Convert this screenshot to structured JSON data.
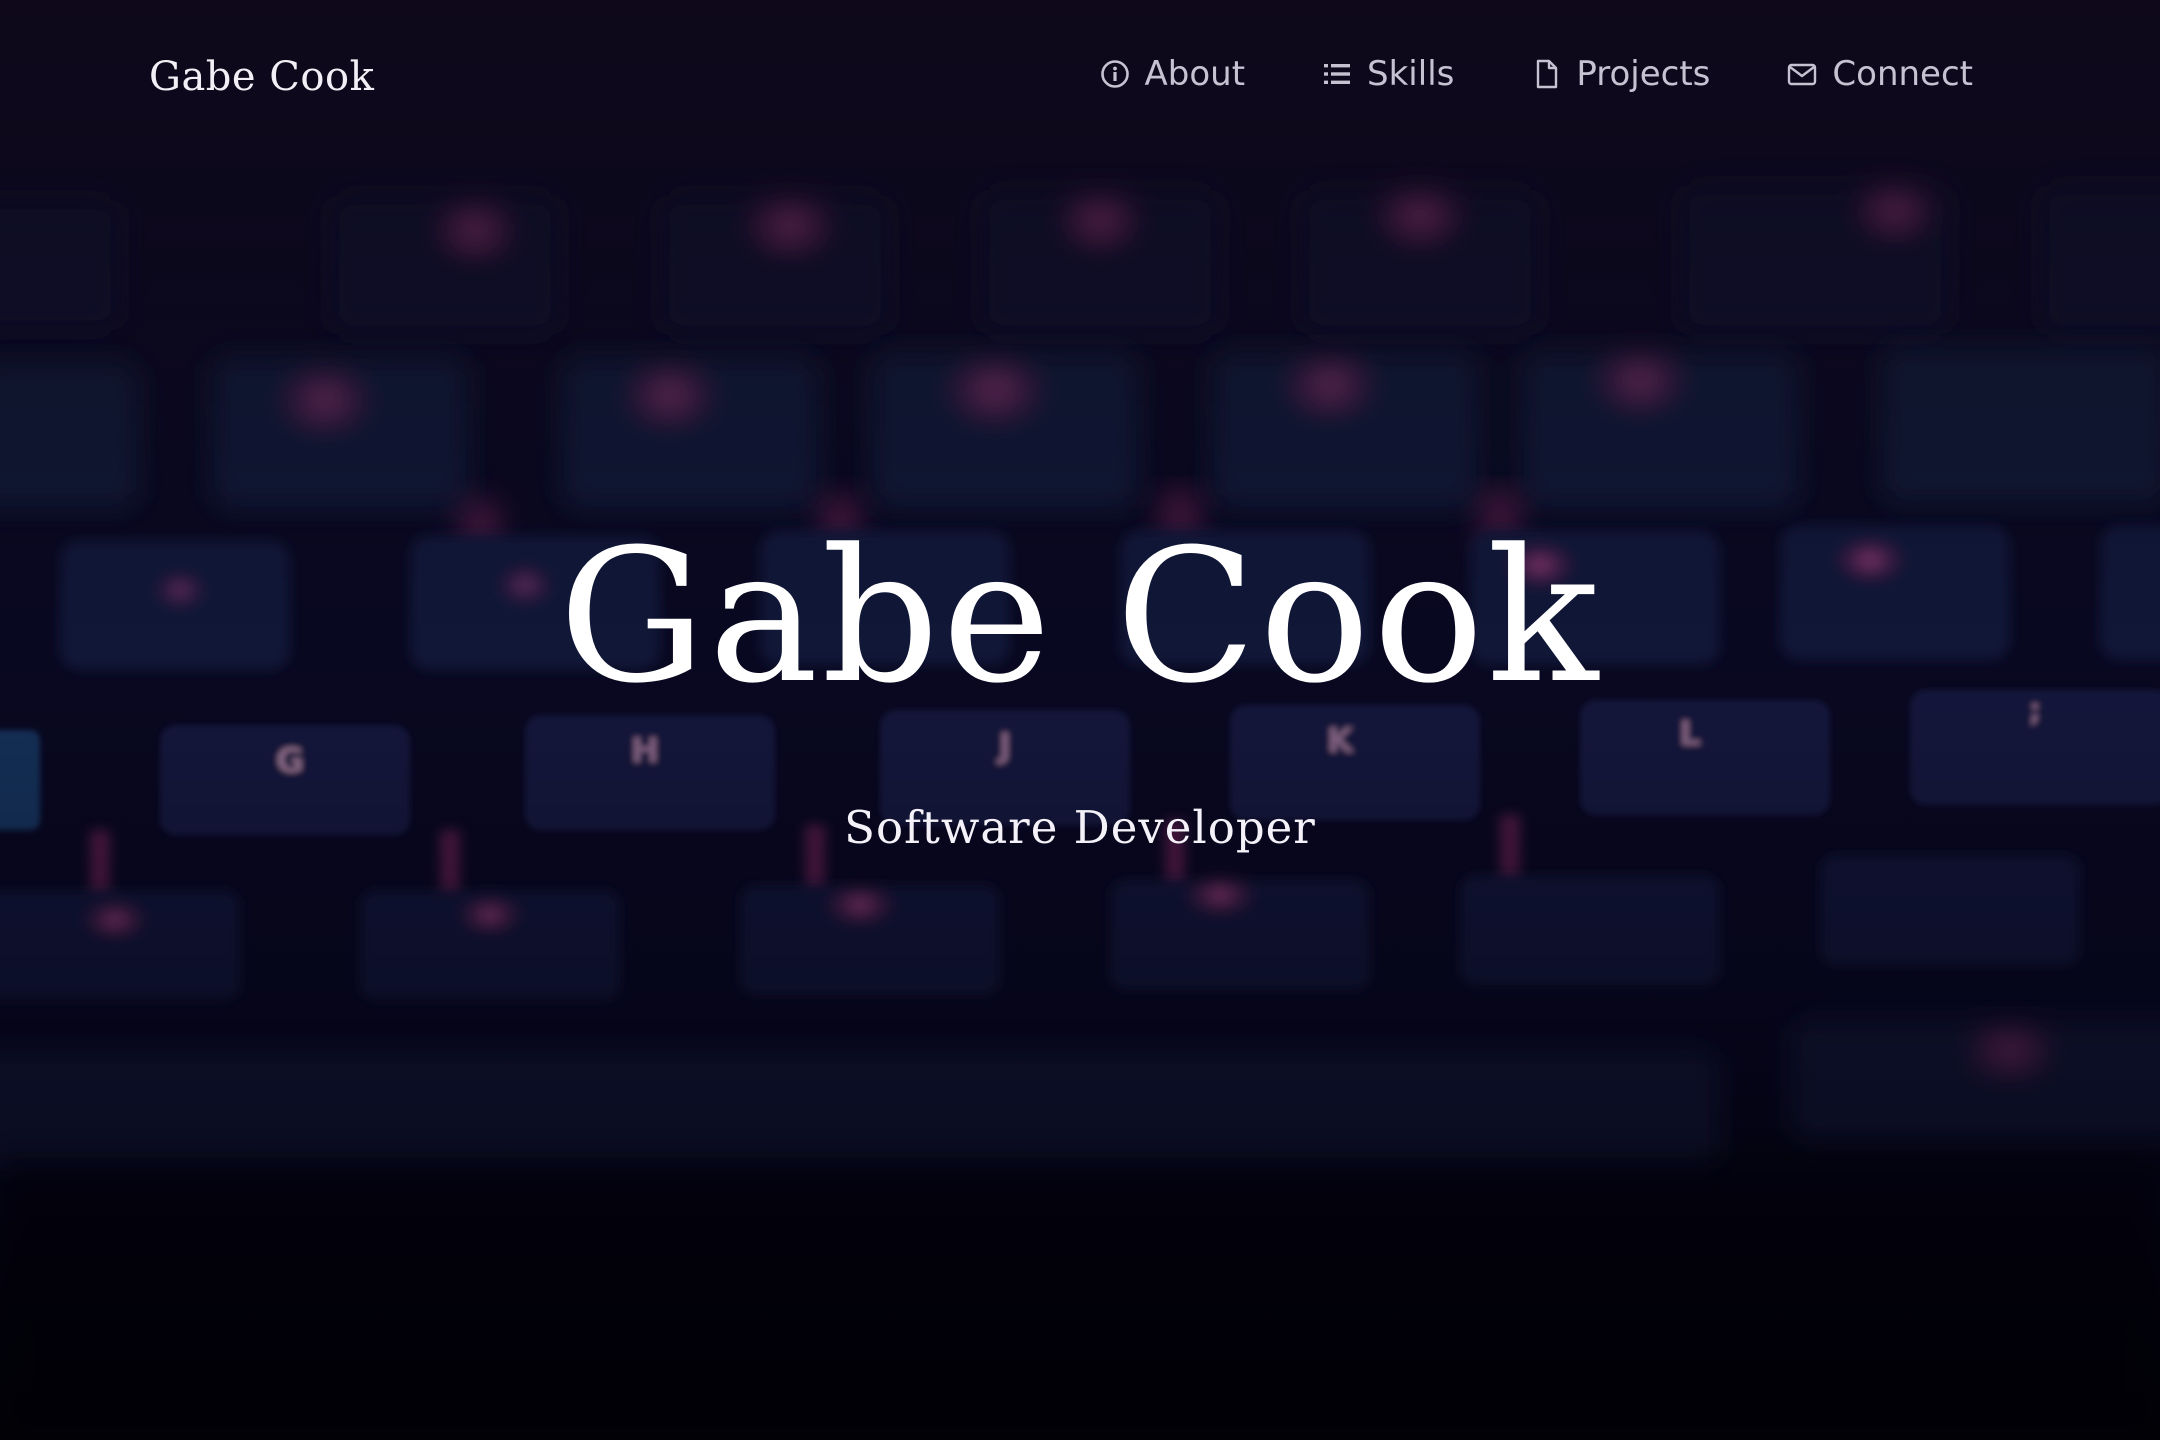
{
  "navbar": {
    "brand": "Gabe Cook",
    "items": [
      {
        "label": "About",
        "icon": "info-circle-icon"
      },
      {
        "label": "Skills",
        "icon": "list-icon"
      },
      {
        "label": "Projects",
        "icon": "file-icon"
      },
      {
        "label": "Connect",
        "icon": "envelope-icon"
      }
    ]
  },
  "hero": {
    "title": "Gabe Cook",
    "subtitle": "Software Developer",
    "background": "keyboard-photo"
  },
  "colors": {
    "background": "#07051a",
    "key_cap": "#131a3a",
    "key_glow": "#c0448a",
    "text": "#ffffff",
    "nav_text": "#c6c2d2"
  }
}
